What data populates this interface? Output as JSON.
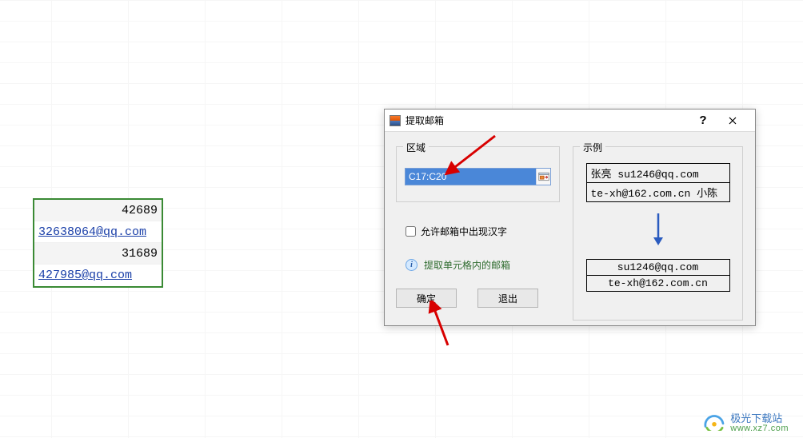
{
  "cells": {
    "c0": "42689",
    "c1": "32638064@qq.com",
    "c2": "31689",
    "c3": "427985@qq.com"
  },
  "dialog": {
    "title": "提取邮箱",
    "group_region": "区域",
    "group_example": "示例",
    "range_value": "C17:C20",
    "checkbox_label": "允许邮箱中出现汉字",
    "hint": "提取单元格内的邮箱",
    "ok": "确定",
    "cancel": "退出"
  },
  "example": {
    "in0": "张亮 su1246@qq.com",
    "in1": "te-xh@162.com.cn 小陈",
    "out0": "su1246@qq.com",
    "out1": "te-xh@162.com.cn"
  },
  "watermark": {
    "brand": "极光下载站",
    "site": "www.xz7.com"
  }
}
